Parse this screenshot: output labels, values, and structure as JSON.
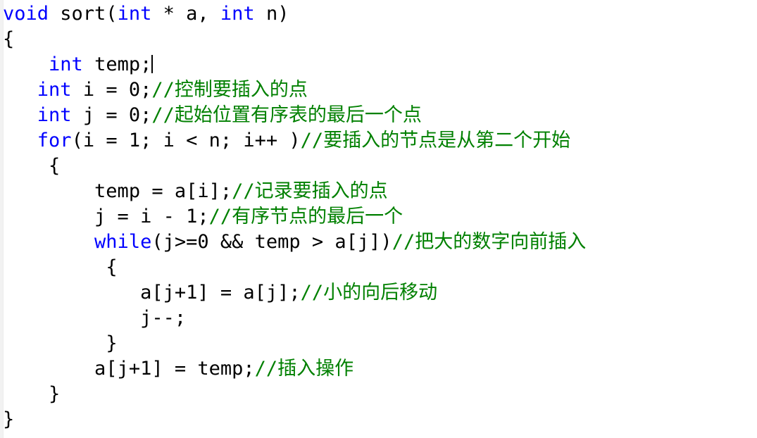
{
  "editor": {
    "language": "C",
    "background_color": "#ffffff",
    "keyword_color": "#0000ff",
    "comment_color": "#008000",
    "text_color": "#000000",
    "caret_visible": true
  },
  "code": {
    "lines": [
      {
        "id": "line-1",
        "indent": "",
        "tokens": [
          {
            "type": "kw",
            "text": "void"
          },
          {
            "type": "plain",
            "text": " sort("
          },
          {
            "type": "kw",
            "text": "int"
          },
          {
            "type": "plain",
            "text": " * a, "
          },
          {
            "type": "kw",
            "text": "int"
          },
          {
            "type": "plain",
            "text": " n)"
          }
        ]
      },
      {
        "id": "line-2",
        "indent": "",
        "tokens": [
          {
            "type": "plain",
            "text": "{"
          }
        ]
      },
      {
        "id": "line-3",
        "indent": "    ",
        "tokens": [
          {
            "type": "kw",
            "text": "int"
          },
          {
            "type": "plain",
            "text": " temp;"
          },
          {
            "type": "caret",
            "text": ""
          }
        ]
      },
      {
        "id": "line-4",
        "indent": "   ",
        "tokens": [
          {
            "type": "kw",
            "text": "int"
          },
          {
            "type": "plain",
            "text": " i = 0;"
          },
          {
            "type": "cmt",
            "text": "//控制要插入的点"
          }
        ]
      },
      {
        "id": "line-5",
        "indent": "   ",
        "tokens": [
          {
            "type": "kw",
            "text": "int"
          },
          {
            "type": "plain",
            "text": " j = 0;"
          },
          {
            "type": "cmt",
            "text": "//起始位置有序表的最后一个点"
          }
        ]
      },
      {
        "id": "line-6",
        "indent": "   ",
        "tokens": [
          {
            "type": "kw",
            "text": "for"
          },
          {
            "type": "plain",
            "text": "(i = 1; i < n; i++ )"
          },
          {
            "type": "cmt",
            "text": "//要插入的节点是从第二个开始"
          }
        ]
      },
      {
        "id": "line-7",
        "indent": "    ",
        "tokens": [
          {
            "type": "plain",
            "text": "{"
          }
        ]
      },
      {
        "id": "line-8",
        "indent": "        ",
        "tokens": [
          {
            "type": "plain",
            "text": "temp = a[i];"
          },
          {
            "type": "cmt",
            "text": "//记录要插入的点"
          }
        ]
      },
      {
        "id": "line-9",
        "indent": "        ",
        "tokens": [
          {
            "type": "plain",
            "text": "j = i - 1;"
          },
          {
            "type": "cmt",
            "text": "//有序节点的最后一个"
          }
        ]
      },
      {
        "id": "line-10",
        "indent": "        ",
        "tokens": [
          {
            "type": "kw",
            "text": "while"
          },
          {
            "type": "plain",
            "text": "(j>=0 && temp > a[j])"
          },
          {
            "type": "cmt",
            "text": "//把大的数字向前插入"
          }
        ]
      },
      {
        "id": "line-11",
        "indent": "         ",
        "tokens": [
          {
            "type": "plain",
            "text": "{"
          }
        ]
      },
      {
        "id": "line-12",
        "indent": "            ",
        "tokens": [
          {
            "type": "plain",
            "text": "a[j+1] = a[j];"
          },
          {
            "type": "cmt",
            "text": "//小的向后移动"
          }
        ]
      },
      {
        "id": "line-13",
        "indent": "            ",
        "tokens": [
          {
            "type": "plain",
            "text": "j--;"
          }
        ]
      },
      {
        "id": "line-14",
        "indent": "         ",
        "tokens": [
          {
            "type": "plain",
            "text": "}"
          }
        ]
      },
      {
        "id": "line-15",
        "indent": "        ",
        "tokens": [
          {
            "type": "plain",
            "text": "a[j+1] = temp;"
          },
          {
            "type": "cmt",
            "text": "//插入操作"
          }
        ]
      },
      {
        "id": "line-16",
        "indent": "    ",
        "tokens": [
          {
            "type": "plain",
            "text": "}"
          }
        ]
      },
      {
        "id": "line-17",
        "indent": "",
        "tokens": [
          {
            "type": "plain",
            "text": "}"
          }
        ]
      }
    ]
  }
}
